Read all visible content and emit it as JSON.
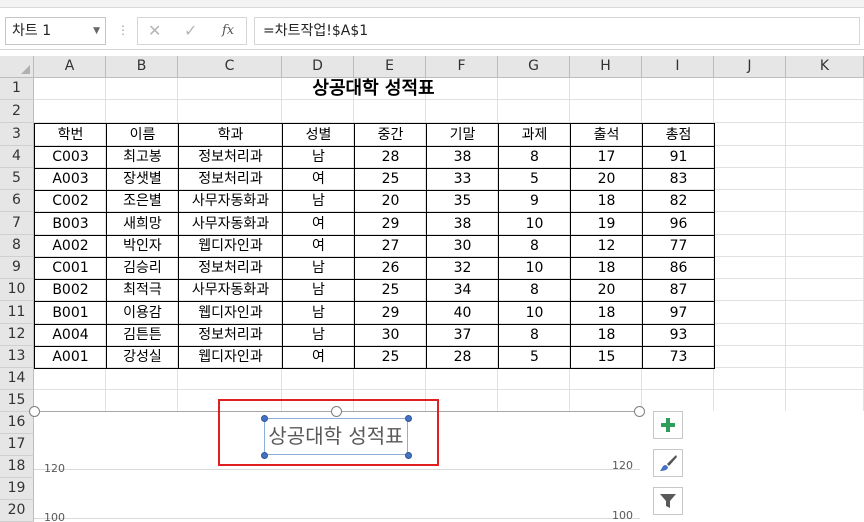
{
  "name_box": "차트 1",
  "formula": "=차트작업!$A$1",
  "columns": [
    "A",
    "B",
    "C",
    "D",
    "E",
    "F",
    "G",
    "H",
    "I",
    "J",
    "K"
  ],
  "rows": [
    "1",
    "2",
    "3",
    "4",
    "5",
    "6",
    "7",
    "8",
    "9",
    "10",
    "11",
    "12",
    "13",
    "14",
    "15",
    "16",
    "17",
    "18",
    "19",
    "20"
  ],
  "title": "상공대학 성적표",
  "table": {
    "headers": [
      "학번",
      "이름",
      "학과",
      "성별",
      "중간",
      "기말",
      "과제",
      "출석",
      "총점"
    ],
    "data": [
      [
        "C003",
        "최고봉",
        "정보처리과",
        "남",
        "28",
        "38",
        "8",
        "17",
        "91"
      ],
      [
        "A003",
        "장샛별",
        "정보처리과",
        "여",
        "25",
        "33",
        "5",
        "20",
        "83"
      ],
      [
        "C002",
        "조은별",
        "사무자동화과",
        "남",
        "20",
        "35",
        "9",
        "18",
        "82"
      ],
      [
        "B003",
        "새희망",
        "사무자동화과",
        "여",
        "29",
        "38",
        "10",
        "19",
        "96"
      ],
      [
        "A002",
        "박인자",
        "웹디자인과",
        "여",
        "27",
        "30",
        "8",
        "12",
        "77"
      ],
      [
        "C001",
        "김승리",
        "정보처리과",
        "남",
        "26",
        "32",
        "10",
        "18",
        "86"
      ],
      [
        "B002",
        "최적극",
        "사무자동화과",
        "남",
        "25",
        "34",
        "8",
        "20",
        "87"
      ],
      [
        "B001",
        "이용감",
        "웹디자인과",
        "남",
        "29",
        "40",
        "10",
        "18",
        "97"
      ],
      [
        "A004",
        "김튼튼",
        "정보처리과",
        "남",
        "30",
        "37",
        "8",
        "18",
        "93"
      ],
      [
        "A001",
        "강성실",
        "웹디자인과",
        "여",
        "25",
        "28",
        "5",
        "15",
        "73"
      ]
    ]
  },
  "chart": {
    "title": "상공대학 성적표",
    "y_ticks": [
      "120",
      "100"
    ],
    "right_y_ticks": [
      "120",
      "100"
    ]
  },
  "chart_buttons": [
    "chart-elements",
    "chart-styles",
    "chart-filters"
  ],
  "colors": {
    "plus": "#2e9e5b",
    "brush": "#4472c4",
    "highlight": "#e02020"
  }
}
